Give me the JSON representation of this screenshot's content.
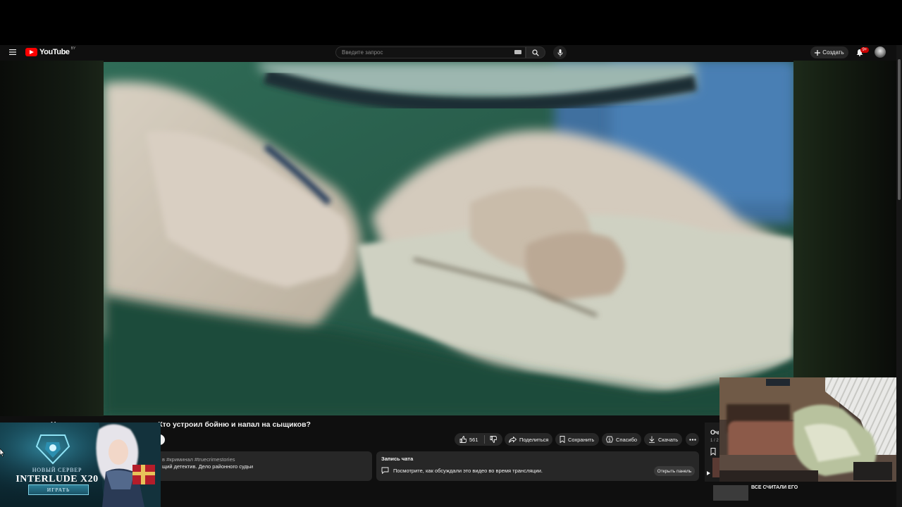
{
  "app": {
    "name": "YouTube",
    "region_code": "BY"
  },
  "search": {
    "placeholder": "Введите запрос"
  },
  "header": {
    "create_label": "Создать",
    "notifications_count": "9+"
  },
  "video": {
    "title_visible": "судьи. Кто устроил бойню и напал на сыщиков?",
    "title_lead_glyph": "Н"
  },
  "actions": {
    "like_count": "561",
    "share_label": "Поделиться",
    "save_label": "Сохранить",
    "thanks_label": "Спасибо",
    "download_label": "Скачать"
  },
  "description": {
    "tags": "в #криминал #truecrimestories",
    "text": "щий детектив. Дело районного судьи"
  },
  "chat": {
    "title": "Запись чата",
    "message": "Посмотрите, как обсуждали это видео во время трансляции.",
    "open_button": "Открыть панель"
  },
  "queue": {
    "title": "Оч",
    "count": "1 / 2",
    "next_title": "ВСЕ СЧИТАЛИ ЕГО"
  },
  "ad": {
    "line1": "НОВЫЙ СЕРВЕР",
    "line2": "INTERLUDE X20",
    "button": "ИГРАТЬ"
  },
  "colors": {
    "brand_red": "#ff0000",
    "page_bg": "#0f0f0f",
    "pill_bg": "#272727",
    "badge_red": "#cc0000"
  }
}
